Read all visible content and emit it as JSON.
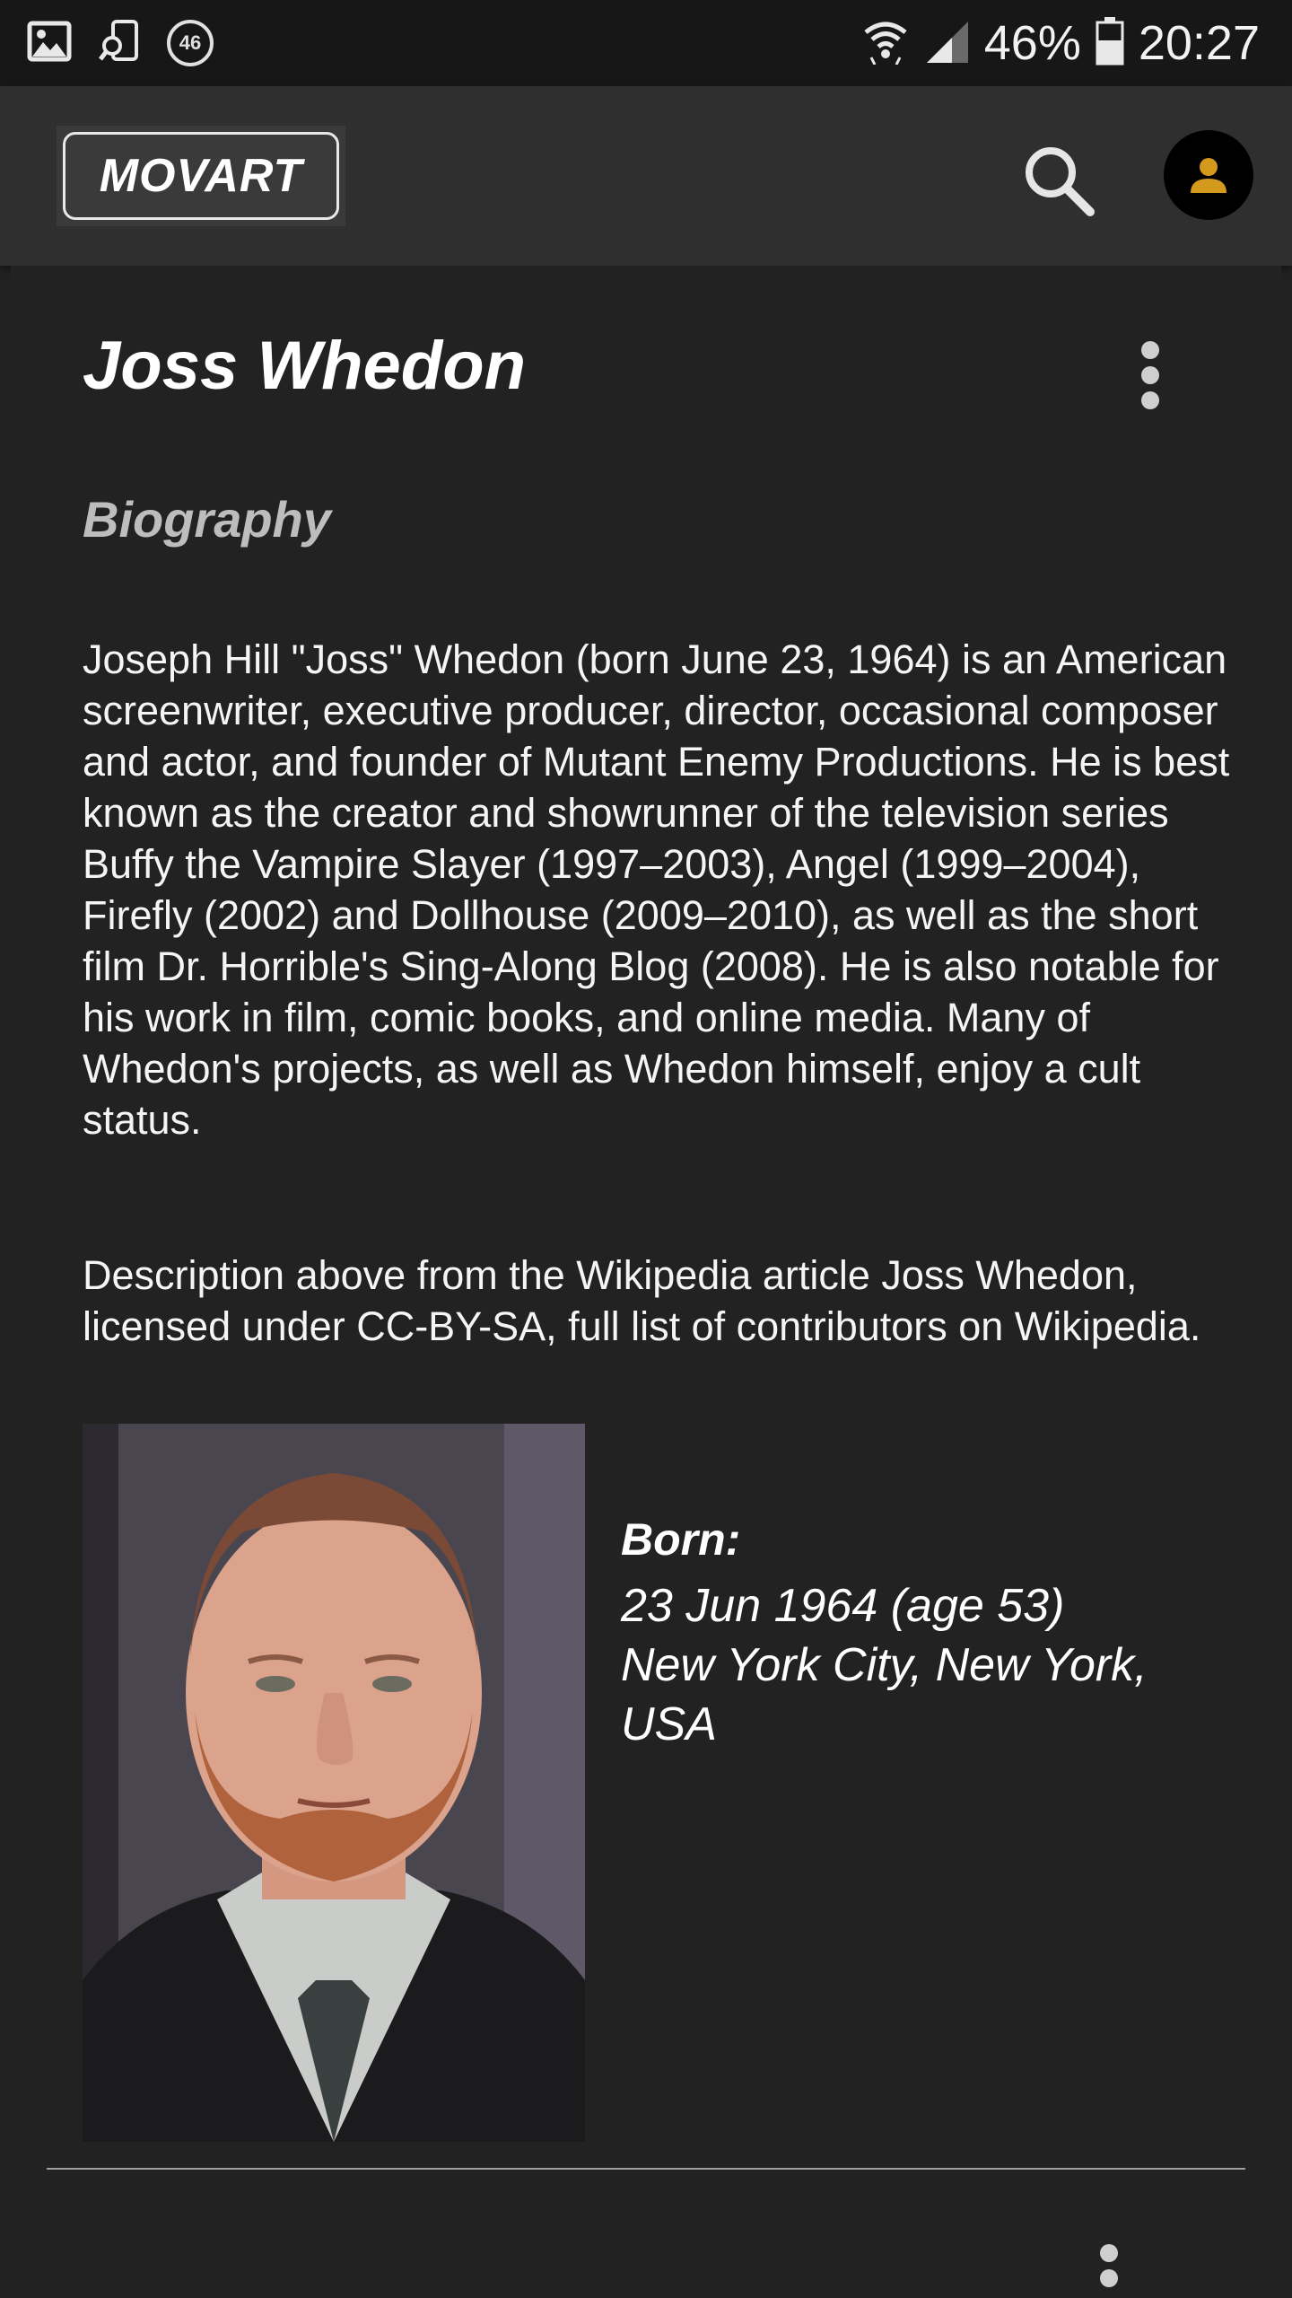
{
  "status_bar": {
    "notification_count": "46",
    "battery_percent": "46%",
    "time": "20:27"
  },
  "app_bar": {
    "logo_text": "MOVART",
    "icons": {
      "search": "search-icon",
      "account": "account-icon"
    },
    "accent_color": "#d49a1e"
  },
  "person": {
    "name": "Joss Whedon",
    "section_heading": "Biography",
    "bio": "Joseph Hill \"Joss\" Whedon (born June 23, 1964) is an American screenwriter, executive producer, director, occasional composer and actor, and founder of Mutant Enemy Productions. He is best known as the creator and showrunner of the television series Buffy the Vampire Slayer (1997–2003), Angel (1999–2004), Firefly (2002) and Dollhouse (2009–2010), as well as the short film Dr. Horrible's Sing-Along Blog (2008). He is also notable for his work in film, comic books, and online media. Many of Whedon's projects, as well as Whedon himself, enjoy a cult status.",
    "attribution": "Description above from the Wikipedia article Joss Whedon, licensed under CC-BY-SA, full list of contributors on Wikipedia.",
    "born_label": "Born:",
    "born_date": "23 Jun 1964 (age 53)",
    "born_place": "New York City, New York, USA"
  }
}
